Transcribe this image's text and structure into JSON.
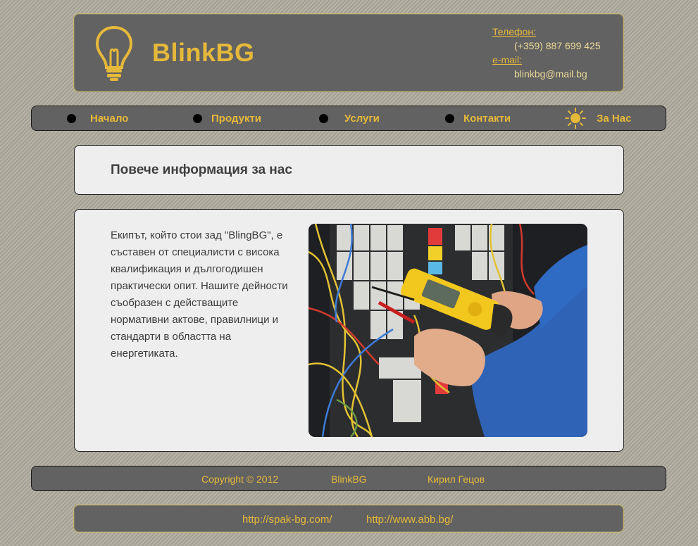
{
  "header": {
    "logo_text": "BlinkBG",
    "phone_label": "Телефон:",
    "phone_value": "(+359) 887 699 425",
    "email_label": "e-mail:",
    "email_value": "blinkbg@mail.bg"
  },
  "nav": {
    "items": [
      {
        "label": "Начало",
        "icon": "bullet-dot-icon"
      },
      {
        "label": "Продукти",
        "icon": "bullet-dot-icon"
      },
      {
        "label": "Услуги",
        "icon": "bullet-dot-icon"
      },
      {
        "label": "Контакти",
        "icon": "bullet-dot-icon"
      },
      {
        "label": "За Нас",
        "icon": "sun-icon",
        "active": true
      }
    ]
  },
  "main": {
    "title": "Повече информация за нас",
    "about_text": "Екипът, който стои зад \"BlingBG\", е съставен от специалисти с висока квалификация и дългогодишен практически опит. Нашите дейности съобразен с действащите нормативни актове, правилници и стандарти в областта на енергетиката."
  },
  "footer": {
    "copyright": "Copyright © 2012",
    "brand": "BlinkBG",
    "author": "Кирил Гецов"
  },
  "links": {
    "link1": "http://spak-bg.com/",
    "link2": "http://www.abb.bg/"
  },
  "colors": {
    "accent": "#e6b93b",
    "panel_dark": "#626262",
    "panel_light": "#eeeeee",
    "background": "#aeaa9d"
  }
}
